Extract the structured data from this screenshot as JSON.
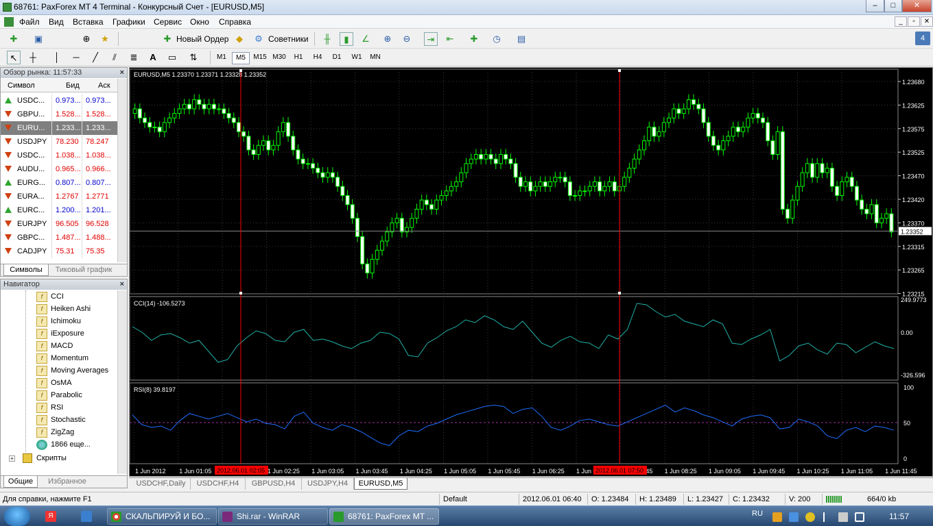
{
  "window": {
    "title": "68761: PaxForex MT 4 Terminal - Конкурсный Счет - [EURUSD,M5]"
  },
  "menu": [
    "Файл",
    "Вид",
    "Вставка",
    "Графики",
    "Сервис",
    "Окно",
    "Справка"
  ],
  "toolbar": {
    "new_order": "Новый Ордер",
    "advisors": "Советники",
    "icons": [
      "new-chart-icon",
      "profiles-icon",
      "crosshair-icon",
      "favorites-icon",
      "new-order-icon",
      "alert-icon",
      "advisors-icon",
      "bar-chart-icon",
      "candles-icon",
      "line-chart-icon",
      "zoom-in-icon",
      "zoom-out-icon",
      "autoscroll-icon",
      "chart-shift-icon",
      "indicators-icon",
      "periods-icon",
      "templates-icon"
    ]
  },
  "timeframes": [
    "M1",
    "M5",
    "M15",
    "M30",
    "H1",
    "H4",
    "D1",
    "W1",
    "MN"
  ],
  "active_timeframe": "M5",
  "market_watch": {
    "title": "Обзор рынка: 11:57:33",
    "col_symbol": "Символ",
    "col_bid": "Бид",
    "col_ask": "Аск",
    "rows": [
      {
        "symbol": "USDC...",
        "bid": "0.973...",
        "ask": "0.973...",
        "dir": "up",
        "color": "#0000cc"
      },
      {
        "symbol": "GBPU...",
        "bid": "1.528...",
        "ask": "1.528...",
        "dir": "down",
        "color": "#e00000"
      },
      {
        "symbol": "EURU...",
        "bid": "1.233...",
        "ask": "1.233...",
        "dir": "down",
        "color": "#ffffff",
        "selected": true
      },
      {
        "symbol": "USDJPY",
        "bid": "78.230",
        "ask": "78.247",
        "dir": "down",
        "color": "#e00000"
      },
      {
        "symbol": "USDC...",
        "bid": "1.038...",
        "ask": "1.038...",
        "dir": "down",
        "color": "#e00000"
      },
      {
        "symbol": "AUDU...",
        "bid": "0.965...",
        "ask": "0.966...",
        "dir": "down",
        "color": "#e00000"
      },
      {
        "symbol": "EURG...",
        "bid": "0.807...",
        "ask": "0.807...",
        "dir": "up",
        "color": "#0000cc"
      },
      {
        "symbol": "EURA...",
        "bid": "1.2767",
        "ask": "1.2771",
        "dir": "down",
        "color": "#e00000"
      },
      {
        "symbol": "EURC...",
        "bid": "1.200...",
        "ask": "1.201...",
        "dir": "up",
        "color": "#0000cc"
      },
      {
        "symbol": "EURJPY",
        "bid": "96.505",
        "ask": "96.528",
        "dir": "down",
        "color": "#e00000"
      },
      {
        "symbol": "GBPC...",
        "bid": "1.487...",
        "ask": "1.488...",
        "dir": "down",
        "color": "#e00000"
      },
      {
        "symbol": "CADJPY",
        "bid": "75.31",
        "ask": "75.35",
        "dir": "down",
        "color": "#e00000"
      }
    ],
    "tab_symbols": "Символы",
    "tab_tick": "Тиковый график"
  },
  "navigator": {
    "title": "Навигатор",
    "items": [
      "CCI",
      "Heiken Ashi",
      "Ichimoku",
      "iExposure",
      "MACD",
      "Momentum",
      "Moving Averages",
      "OsMA",
      "Parabolic",
      "RSI",
      "Stochastic",
      "ZigZag",
      "1866 еще..."
    ],
    "scripts": "Скрипты",
    "tab_general": "Общие",
    "tab_favorites": "Избранное"
  },
  "chart": {
    "header": "EURUSD,M5  1.23370 1.23371 1.23328 1.23352",
    "current_price": "1.23352",
    "price_labels": [
      "1.23680",
      "1.23625",
      "1.23575",
      "1.23525",
      "1.23470",
      "1.23420",
      "1.23370",
      "1.23315",
      "1.23265",
      "1.23215"
    ],
    "cci_header": "CCI(14) -106.5273",
    "cci_labels": [
      "249.9773",
      "0.00",
      "-326.596"
    ],
    "rsi_header": "RSI(8) 39.8197",
    "rsi_labels": [
      "100",
      "50",
      "0"
    ],
    "time_labels": [
      "1 Jun 2012",
      "1 Jun 01:05",
      "1 Jun 01:45",
      "1 Jun 02:25",
      "1 Jun 03:05",
      "1 Jun 03:45",
      "1 Jun 04:25",
      "1 Jun 05:05",
      "1 Jun 05:45",
      "1 Jun 06:25",
      "1 Jun 07:05",
      "1 Jun 07:45",
      "1 Jun 08:25",
      "1 Jun 09:05",
      "1 Jun 09:45",
      "1 Jun 10:25",
      "1 Jun 11:05",
      "1 Jun 11:45"
    ],
    "marker_labels": [
      "2012.06.01 02:05",
      "2012.06.01 07:50"
    ],
    "colors": {
      "bull": "#00ff00",
      "bear": "#00ff00",
      "grid": "#3a3a3a",
      "cci": "#20b2aa",
      "rsi": "#1e6fff",
      "marker": "#ff0000"
    }
  },
  "chart_tabs": [
    "USDCHF,Daily",
    "USDCHF,H4",
    "GBPUSD,H4",
    "USDJPY,H4",
    "EURUSD,M5"
  ],
  "active_chart_tab": "EURUSD,M5",
  "status": {
    "help": "Для справки, нажмите F1",
    "profile": "Default",
    "datetime": "2012.06.01 06:40",
    "open": "O: 1.23484",
    "high": "H: 1.23489",
    "low": "L: 1.23427",
    "close": "C: 1.23432",
    "volume": "V: 200",
    "traffic": "664/0 kb"
  },
  "taskbar": {
    "tasks": [
      "СКАЛЬПИРУЙ И БО...",
      "Shi.rar - WinRAR",
      "68761: PaxForex MT ..."
    ],
    "lang": "RU",
    "clock": "11:57"
  }
}
